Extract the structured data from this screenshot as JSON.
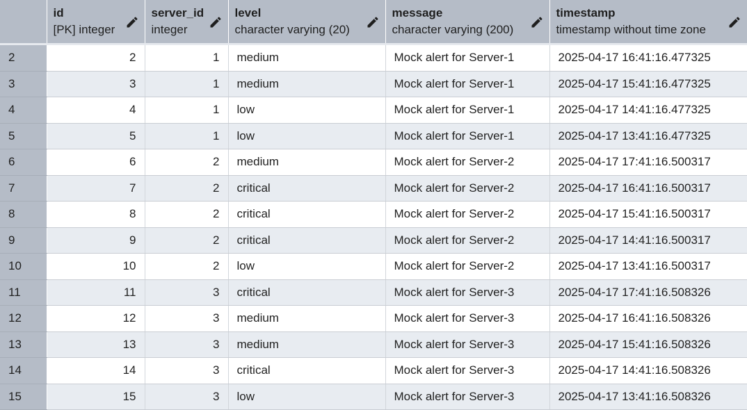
{
  "columns": [
    {
      "name": "id",
      "type": "[PK] integer"
    },
    {
      "name": "server_id",
      "type": "integer"
    },
    {
      "name": "level",
      "type": "character varying (20)"
    },
    {
      "name": "message",
      "type": "character varying (200)"
    },
    {
      "name": "timestamp",
      "type": "timestamp without time zone"
    }
  ],
  "rows": [
    {
      "rownum": "2",
      "id": "2",
      "server_id": "1",
      "level": "medium",
      "message": "Mock alert for Server-1",
      "timestamp": "2025-04-17 16:41:16.477325"
    },
    {
      "rownum": "3",
      "id": "3",
      "server_id": "1",
      "level": "medium",
      "message": "Mock alert for Server-1",
      "timestamp": "2025-04-17 15:41:16.477325"
    },
    {
      "rownum": "4",
      "id": "4",
      "server_id": "1",
      "level": "low",
      "message": "Mock alert for Server-1",
      "timestamp": "2025-04-17 14:41:16.477325"
    },
    {
      "rownum": "5",
      "id": "5",
      "server_id": "1",
      "level": "low",
      "message": "Mock alert for Server-1",
      "timestamp": "2025-04-17 13:41:16.477325"
    },
    {
      "rownum": "6",
      "id": "6",
      "server_id": "2",
      "level": "medium",
      "message": "Mock alert for Server-2",
      "timestamp": "2025-04-17 17:41:16.500317"
    },
    {
      "rownum": "7",
      "id": "7",
      "server_id": "2",
      "level": "critical",
      "message": "Mock alert for Server-2",
      "timestamp": "2025-04-17 16:41:16.500317"
    },
    {
      "rownum": "8",
      "id": "8",
      "server_id": "2",
      "level": "critical",
      "message": "Mock alert for Server-2",
      "timestamp": "2025-04-17 15:41:16.500317"
    },
    {
      "rownum": "9",
      "id": "9",
      "server_id": "2",
      "level": "critical",
      "message": "Mock alert for Server-2",
      "timestamp": "2025-04-17 14:41:16.500317"
    },
    {
      "rownum": "10",
      "id": "10",
      "server_id": "2",
      "level": "low",
      "message": "Mock alert for Server-2",
      "timestamp": "2025-04-17 13:41:16.500317"
    },
    {
      "rownum": "11",
      "id": "11",
      "server_id": "3",
      "level": "critical",
      "message": "Mock alert for Server-3",
      "timestamp": "2025-04-17 17:41:16.508326"
    },
    {
      "rownum": "12",
      "id": "12",
      "server_id": "3",
      "level": "medium",
      "message": "Mock alert for Server-3",
      "timestamp": "2025-04-17 16:41:16.508326"
    },
    {
      "rownum": "13",
      "id": "13",
      "server_id": "3",
      "level": "medium",
      "message": "Mock alert for Server-3",
      "timestamp": "2025-04-17 15:41:16.508326"
    },
    {
      "rownum": "14",
      "id": "14",
      "server_id": "3",
      "level": "critical",
      "message": "Mock alert for Server-3",
      "timestamp": "2025-04-17 14:41:16.508326"
    },
    {
      "rownum": "15",
      "id": "15",
      "server_id": "3",
      "level": "low",
      "message": "Mock alert for Server-3",
      "timestamp": "2025-04-17 13:41:16.508326"
    }
  ],
  "icons": {
    "column_edit": "pencil-icon"
  },
  "colors": {
    "header_bg": "#b5bcc7",
    "row_alt_bg": "#e8ecf1",
    "row_bg": "#ffffff"
  }
}
